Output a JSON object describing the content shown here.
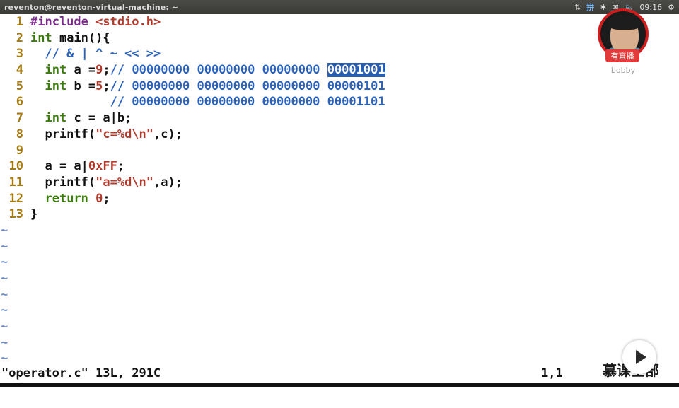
{
  "topbar": {
    "title": "reventon@reventon-virtual-machine: ~",
    "tray": {
      "network_label": "⇅",
      "ime_label": "拼",
      "bluetooth_label": "✱",
      "mail_label": "✉",
      "volume_label": "🔈",
      "clock": "09:16",
      "settings_label": "⚙"
    }
  },
  "editor": {
    "line_numbers": [
      "1",
      "2",
      "3",
      "4",
      "5",
      "6",
      "7",
      "8",
      "9",
      "10",
      "11",
      "12",
      "13"
    ],
    "lines": [
      {
        "segments": [
          {
            "t": "#include ",
            "c": "pp"
          },
          {
            "t": "<stdio.h>",
            "c": "str"
          }
        ]
      },
      {
        "segments": [
          {
            "t": "int",
            "c": "kw"
          },
          {
            "t": " main(){",
            "c": ""
          }
        ]
      },
      {
        "segments": [
          {
            "t": "  // & | ^ ~ << >>",
            "c": "cm"
          }
        ]
      },
      {
        "segments": [
          {
            "t": "  ",
            "c": ""
          },
          {
            "t": "int",
            "c": "kw"
          },
          {
            "t": " a =",
            "c": ""
          },
          {
            "t": "9",
            "c": "num"
          },
          {
            "t": ";",
            "c": ""
          },
          {
            "t": "// 00000000 00000000 00000000 ",
            "c": "cm"
          },
          {
            "t": "00001001",
            "c": "hl"
          }
        ]
      },
      {
        "segments": [
          {
            "t": "  ",
            "c": ""
          },
          {
            "t": "int",
            "c": "kw"
          },
          {
            "t": " b =",
            "c": ""
          },
          {
            "t": "5",
            "c": "num"
          },
          {
            "t": ";",
            "c": ""
          },
          {
            "t": "// 00000000 00000000 00000000 00000101",
            "c": "cm"
          }
        ]
      },
      {
        "segments": [
          {
            "t": "           ",
            "c": ""
          },
          {
            "t": "// 00000000 00000000 00000000 00001101",
            "c": "cm"
          }
        ]
      },
      {
        "segments": [
          {
            "t": "  ",
            "c": ""
          },
          {
            "t": "int",
            "c": "kw"
          },
          {
            "t": " c = a|b;",
            "c": ""
          }
        ]
      },
      {
        "segments": [
          {
            "t": "  printf(",
            "c": ""
          },
          {
            "t": "\"c=%d\\n\"",
            "c": "str"
          },
          {
            "t": ",c);",
            "c": ""
          }
        ]
      },
      {
        "segments": []
      },
      {
        "segments": [
          {
            "t": "  a = a|",
            "c": ""
          },
          {
            "t": "0xFF",
            "c": "num"
          },
          {
            "t": ";",
            "c": ""
          }
        ]
      },
      {
        "segments": [
          {
            "t": "  printf(",
            "c": ""
          },
          {
            "t": "\"a=%d\\n\"",
            "c": "str"
          },
          {
            "t": ",a);",
            "c": ""
          }
        ]
      },
      {
        "segments": [
          {
            "t": "  ",
            "c": ""
          },
          {
            "t": "return",
            "c": "kw"
          },
          {
            "t": " ",
            "c": ""
          },
          {
            "t": "0",
            "c": "num"
          },
          {
            "t": ";",
            "c": ""
          }
        ]
      },
      {
        "segments": [
          {
            "t": "}",
            "c": ""
          }
        ]
      }
    ],
    "tilde_char": "~",
    "tilde_rows": 9
  },
  "statusline": {
    "file_info": "\"operator.c\" 13L, 291C",
    "cursor_pos": "1,1"
  },
  "overlay": {
    "live_badge": "有直播",
    "streamer_name": "bobby",
    "watermark_text": "慕课全部",
    "colors": {
      "live_red": "#e23b3b",
      "ring_red": "#cc1f1f"
    }
  },
  "colors": {
    "line_number": "#a47a14",
    "keyword": "#3b7a0c",
    "preprocessor": "#7a2a8a",
    "string": "#b03c2e",
    "comment": "#2c62b8",
    "highlight_bg": "#2a5dab",
    "tilde": "#6f8ec7"
  }
}
